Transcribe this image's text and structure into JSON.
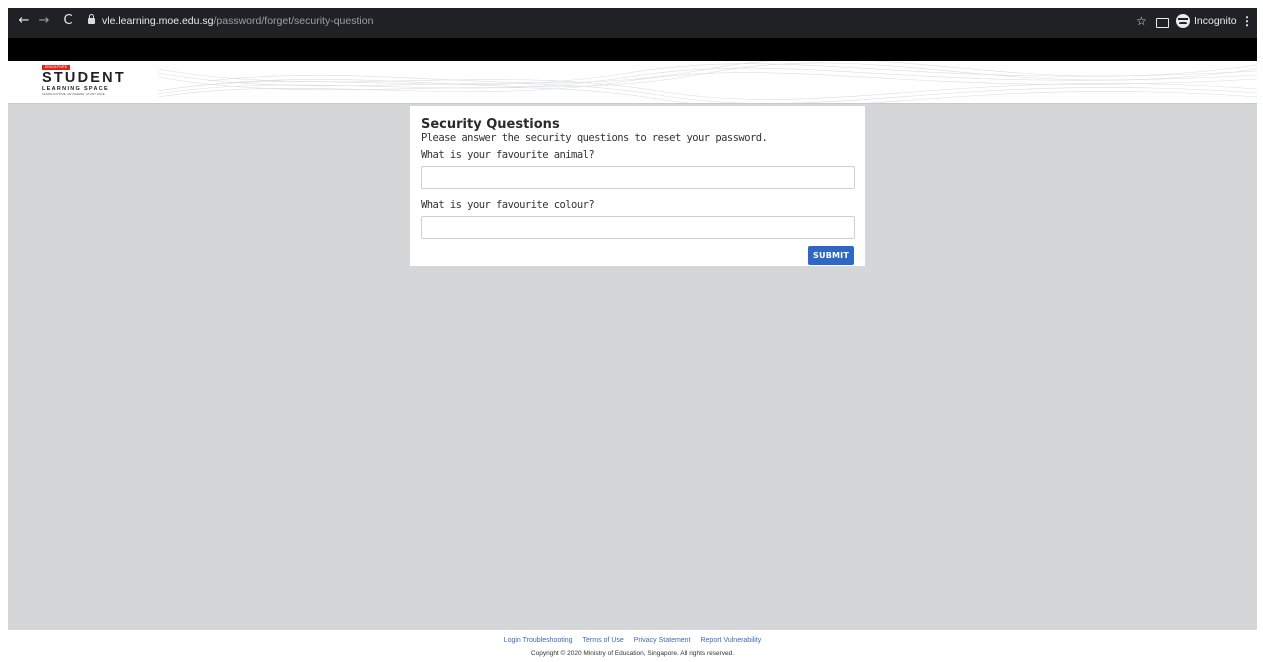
{
  "browser": {
    "url_host": "vle.learning.moe.edu.sg",
    "url_path": "/password/forget/security-question",
    "profile_label": "Incognito",
    "back_glyph": "←",
    "forward_glyph": "→",
    "reload_glyph": "C",
    "star_glyph": "☆",
    "menu_glyph": "⋮",
    "icons": [
      "back-arrow-icon",
      "forward-arrow-icon",
      "reload-icon",
      "lock-icon",
      "star-icon",
      "cast-icon",
      "incognito-icon",
      "kebab-menu-icon"
    ]
  },
  "header": {
    "logo_country": "SINGAPORE",
    "logo_main": "STUDENT",
    "logo_sub": "LEARNING SPACE",
    "logo_tagline": "LEARN ANYTIME, ANYWHERE, AT ANY PACE"
  },
  "form": {
    "title": "Security Questions",
    "subtitle": "Please answer the security questions to reset your password.",
    "questions": [
      {
        "label": "What is your favourite animal?",
        "value": "",
        "placeholder": ""
      },
      {
        "label": "What is your favourite colour?",
        "value": "",
        "placeholder": ""
      }
    ],
    "submit_label": "SUBMIT"
  },
  "footer": {
    "links": [
      "Login Troubleshooting",
      "Terms of Use",
      "Privacy Statement",
      "Report Vulnerability"
    ],
    "copyright": "Copyright © 2020 Ministry of Education, Singapore. All rights reserved."
  },
  "colors": {
    "page_background": "#d5d6d8",
    "browser_bar": "#202124",
    "primary_button": "#2f68c4",
    "link": "#3a6bb6",
    "logo_red": "#e2231a"
  }
}
